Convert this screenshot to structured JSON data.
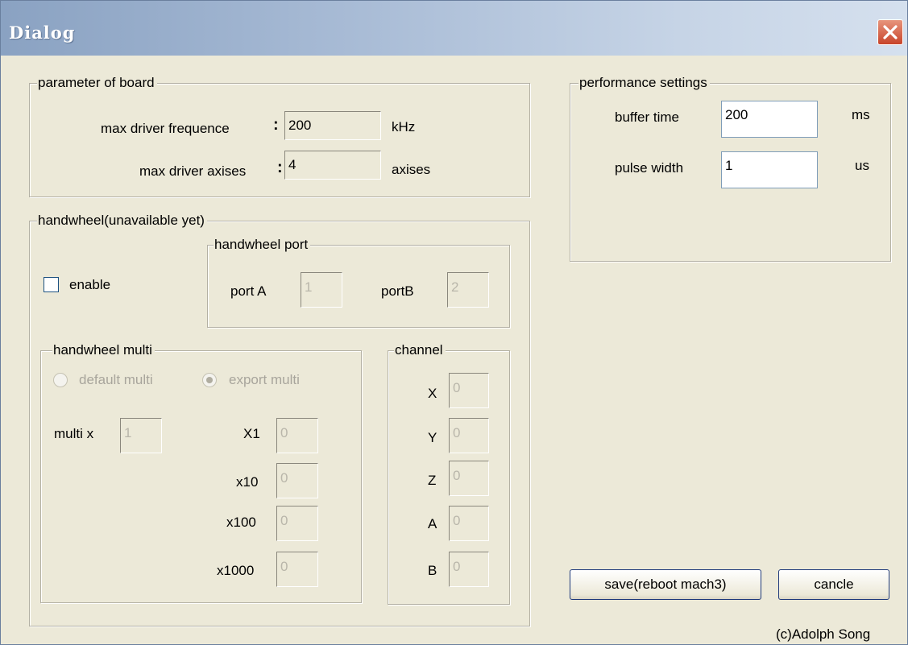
{
  "window": {
    "title": "Dialog"
  },
  "board": {
    "group_title": "parameter of board",
    "freq_label": "max driver frequence",
    "freq_value": "200",
    "freq_unit": "kHz",
    "axes_label": "max driver axises",
    "axes_value": "4",
    "axes_unit": "axises",
    "separator": ":"
  },
  "handwheel": {
    "group_title": "handwheel(unavailable yet)",
    "enable_label": "enable",
    "enable_checked": false,
    "port": {
      "group_title": "handwheel port",
      "port_a_label": "port A",
      "port_a_value": "1",
      "port_b_label": "portB",
      "port_b_value": "2"
    },
    "multi": {
      "group_title": "handwheel multi",
      "default_label": "default multi",
      "export_label": "export multi",
      "selected": "export multi",
      "multi_label": "multi  x",
      "multi_value": "1",
      "rows": [
        {
          "label": "X1",
          "value": "0"
        },
        {
          "label": "x10",
          "value": "0"
        },
        {
          "label": "x100",
          "value": "0"
        },
        {
          "label": "x1000",
          "value": "0"
        }
      ]
    },
    "channel": {
      "group_title": "channel",
      "rows": [
        {
          "label": "X",
          "value": "0"
        },
        {
          "label": "Y",
          "value": "0"
        },
        {
          "label": "Z",
          "value": "0"
        },
        {
          "label": "A",
          "value": "0"
        },
        {
          "label": "B",
          "value": "0"
        }
      ]
    }
  },
  "performance": {
    "group_title": "performance settings",
    "buffer_label": "buffer time",
    "buffer_value": "200",
    "buffer_unit": "ms",
    "pulse_label": "pulse width",
    "pulse_value": "1",
    "pulse_unit": "us"
  },
  "actions": {
    "save_label": "save(reboot mach3)",
    "cancel_label": "cancle"
  },
  "footer": {
    "credit": "(c)Adolph Song"
  },
  "colors": {
    "titlebar": "#a9bcd6",
    "dialog_bg": "#ece9d8",
    "close_button": "#d9583a"
  }
}
